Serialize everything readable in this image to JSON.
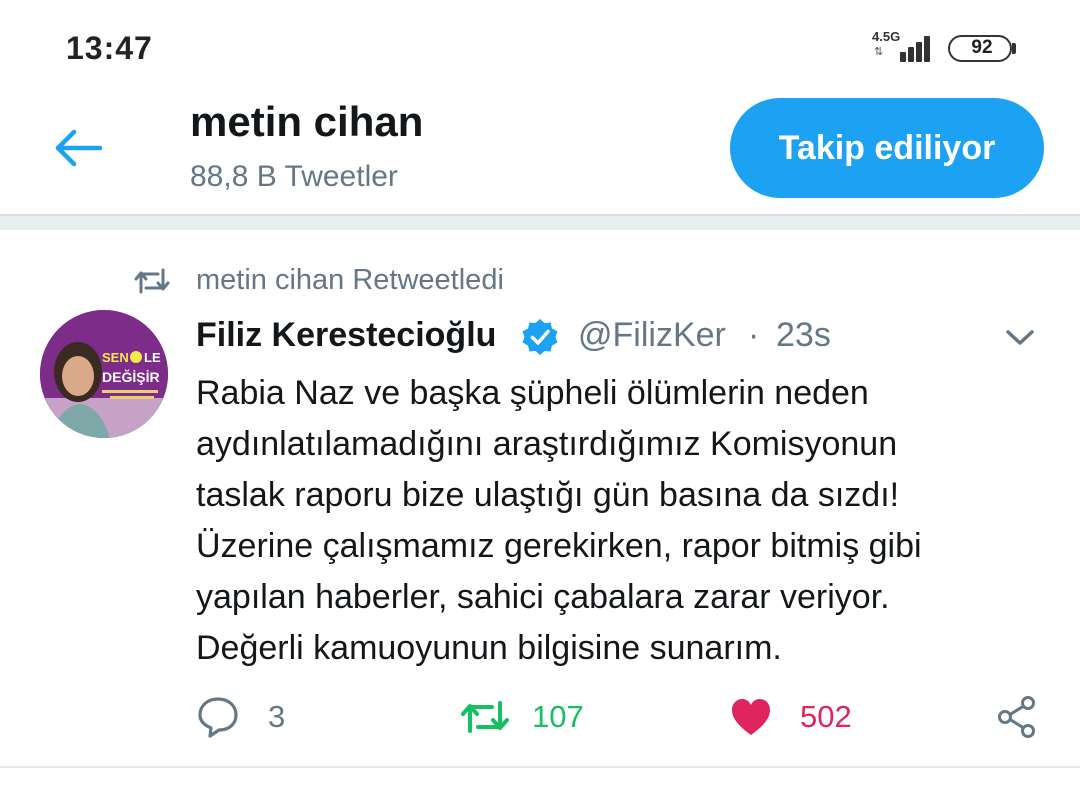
{
  "status_bar": {
    "time": "13:47",
    "network_type": "4.5G",
    "battery": "92"
  },
  "header": {
    "back_icon": "arrow-left-icon",
    "title": "metin cihan",
    "subtitle": "88,8 B Tweetler",
    "follow_button": "Takip ediliyor"
  },
  "tweet": {
    "retweet_label": "metin cihan Retweetledi",
    "author_name": "Filiz Kerestecioğlu",
    "handle": "@FilizKer",
    "separator": "·",
    "time": "23s",
    "avatar_banner": [
      "SEN",
      "LE",
      "DEĞİŞİR"
    ],
    "text_lines": [
      "Rabia Naz ve başka şüpheli ölümlerin neden",
      "aydınlatılamadığını araştırdığımız Komisyonun",
      "taslak raporu bize ulaştığı gün basına da sızdı!",
      "Üzerine çalışmamız gerekirken, rapor bitmiş gibi",
      "yapılan haberler, sahici çabalara zarar veriyor.",
      "Değerli kamuoyunun bilgisine sunarım."
    ],
    "replies": "3",
    "retweets": "107",
    "likes": "502"
  },
  "colors": {
    "accent": "#1da1f2",
    "retweet": "#17bf63",
    "like": "#e0245e",
    "secondary_text": "#657786"
  }
}
